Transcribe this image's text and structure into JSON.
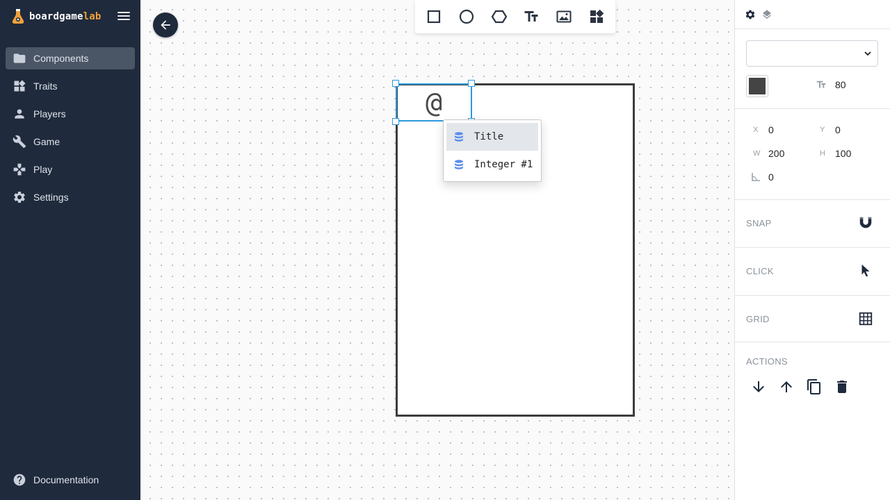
{
  "brand": {
    "name_main": "boardgame",
    "name_accent": "lab",
    "accent_color": "#f0a13a"
  },
  "sidebar": {
    "items": [
      {
        "label": "Components",
        "icon": "folder-icon",
        "active": true
      },
      {
        "label": "Traits",
        "icon": "widgets-icon",
        "active": false
      },
      {
        "label": "Players",
        "icon": "person-icon",
        "active": false
      },
      {
        "label": "Game",
        "icon": "wrench-icon",
        "active": false
      },
      {
        "label": "Play",
        "icon": "gamepad-icon",
        "active": false
      },
      {
        "label": "Settings",
        "icon": "gear-icon",
        "active": false
      }
    ],
    "documentation": "Documentation"
  },
  "toolbar": {
    "tools": [
      "rectangle-icon",
      "circle-icon",
      "hexagon-icon",
      "text-icon",
      "image-icon",
      "widgets-icon"
    ]
  },
  "canvas": {
    "text_element": "@",
    "autocomplete": [
      {
        "label": "Title",
        "highlighted": true
      },
      {
        "label": "Integer #1",
        "highlighted": false
      }
    ]
  },
  "panel": {
    "font_select_value": "",
    "color": "#444444",
    "font_size": "80",
    "x_label": "X",
    "x": "0",
    "y_label": "Y",
    "y": "0",
    "w_label": "W",
    "w": "200",
    "h_label": "H",
    "h": "100",
    "angle": "0",
    "snap_label": "SNAP",
    "click_label": "CLICK",
    "grid_label": "GRID",
    "actions_label": "ACTIONS"
  },
  "colors": {
    "sidebar_bg": "#1f2a3c",
    "selection": "#2c97de",
    "db_icon": "#5b8def"
  }
}
